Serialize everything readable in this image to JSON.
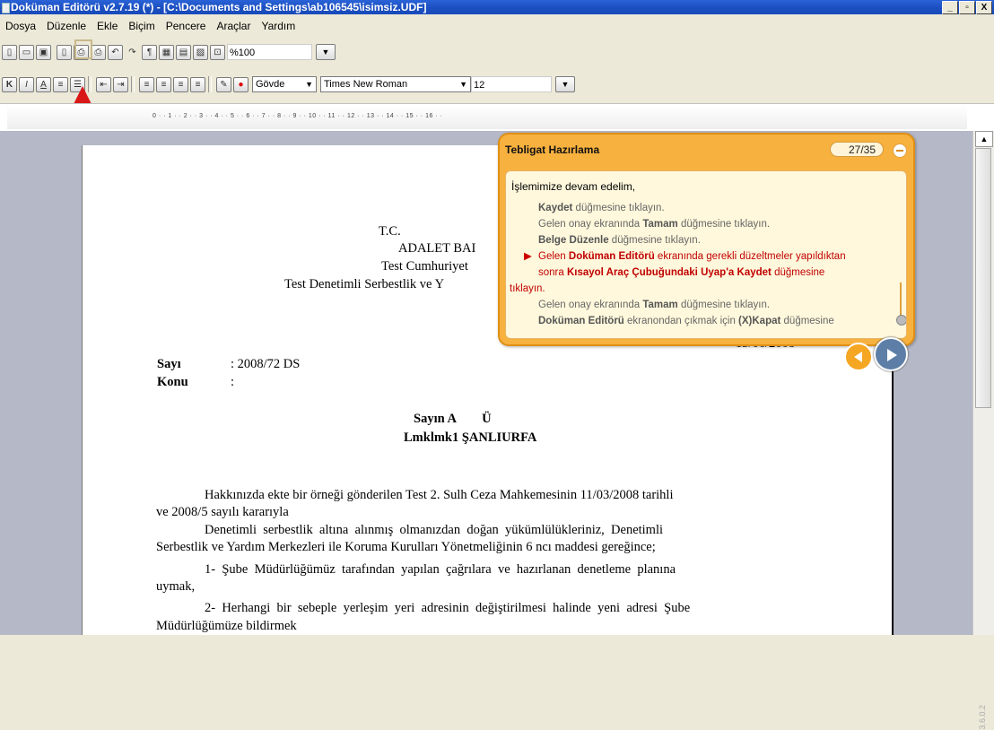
{
  "window": {
    "title": "Doküman Editörü v2.7.19 (*) - [C:\\Documents and Settings\\ab106545\\isimsiz.UDF]",
    "controls": [
      "_",
      "8",
      "X"
    ]
  },
  "menu": [
    "Dosya",
    "Düzenle",
    "Ekle",
    "Biçim",
    "Pencere",
    "Araçlar",
    "Yardım"
  ],
  "toolbar": {
    "zoom": "%100",
    "style": "Gövde",
    "font": "Times New Roman",
    "size": "12"
  },
  "ruler": {
    "marks": "0 · · 1 · · 2 · · 3 · · 4 · · 5 · · 6 · · 7 · · 8 · · 9 · · 10 · · 11 · · 12 · · 13 · · 14 · · 15 · · 16 · ·"
  },
  "document": {
    "header1": "T.C.",
    "header2": "ADALET BAI",
    "header3": "Test Cumhuriyet",
    "header4": "Test Denetimli Serbestlik ve Y",
    "date": "13/06/2008",
    "sayi_label": "Sayı",
    "sayi_value": ": 2008/72 DS",
    "konu_label": "Konu",
    "konu_value": ":",
    "recipient1": "Sayın A        Ü",
    "recipient2": "Lmklmk1 ŞANLIURFA",
    "para1a": "Hakkınızda ekte bir örneği gönderilen Test 2. Sulh Ceza Mahkemesinin 11/03/2008 tarihli",
    "para1b": "ve 2008/5 sayılı kararıyla",
    "para2a": "Denetimli  serbestlik  altına  alınmış  olmanızdan  doğan  yükümlülükleriniz,  Denetimli",
    "para2b": "Serbestlik ve Yardım Merkezleri ile Koruma Kurulları Yönetmeliğinin 6 ncı maddesi gereğince;",
    "item1a": "1-  Şube  Müdürlüğümüz  tarafından  yapılan  çağrılara  ve  hazırlanan  denetleme  planına",
    "item1b": "uymak,",
    "item2a": "2-  Herhangi  bir  sebeple  yerleşim  yeri  adresinin  değiştirilmesi  halinde  yeni  adresi  Şube",
    "item2b": "Müdürlüğümüze bildirmek"
  },
  "popup": {
    "title": "Tebligat Hazırlama",
    "counter": "27/35",
    "intro": "İşlemimize devam edelim,",
    "s1_bold": "Kaydet",
    "s1_rest": " düğmesine tıklayın.",
    "s2_pre": "Gelen onay ekranında ",
    "s2_bold": "Tamam",
    "s2_rest": " düğmesine tıklayın.",
    "s3_bold": "Belge Düzenle",
    "s3_rest": " düğmesine tıklayın.",
    "s4_pre": "Gelen ",
    "s4_bold1": "Doküman Editörü",
    "s4_mid": " ekranında gerekli düzeltmeler yapıldıktan",
    "s4_line2_pre": "sonra ",
    "s4_bold2": "Kısayol Araç Çubuğundaki Uyap'a Kaydet",
    "s4_line2_rest": " düğmesine",
    "s4_line3": "tıklayın.",
    "s5_pre": "Gelen onay ekranında ",
    "s5_bold": "Tamam",
    "s5_rest": " düğmesine tıklayın.",
    "s6_bold1": "Doküman Editörü",
    "s6_mid": " ekranondan çıkmak için ",
    "s6_bold2": "(X)Kapat",
    "s6_rest": " düğmesine"
  },
  "version": "3.6.0.2",
  "colors": {
    "titlebar": "#1c4fc0",
    "popup": "#f7b13f",
    "highlight": "#c00000",
    "arrow": "#d91818"
  }
}
